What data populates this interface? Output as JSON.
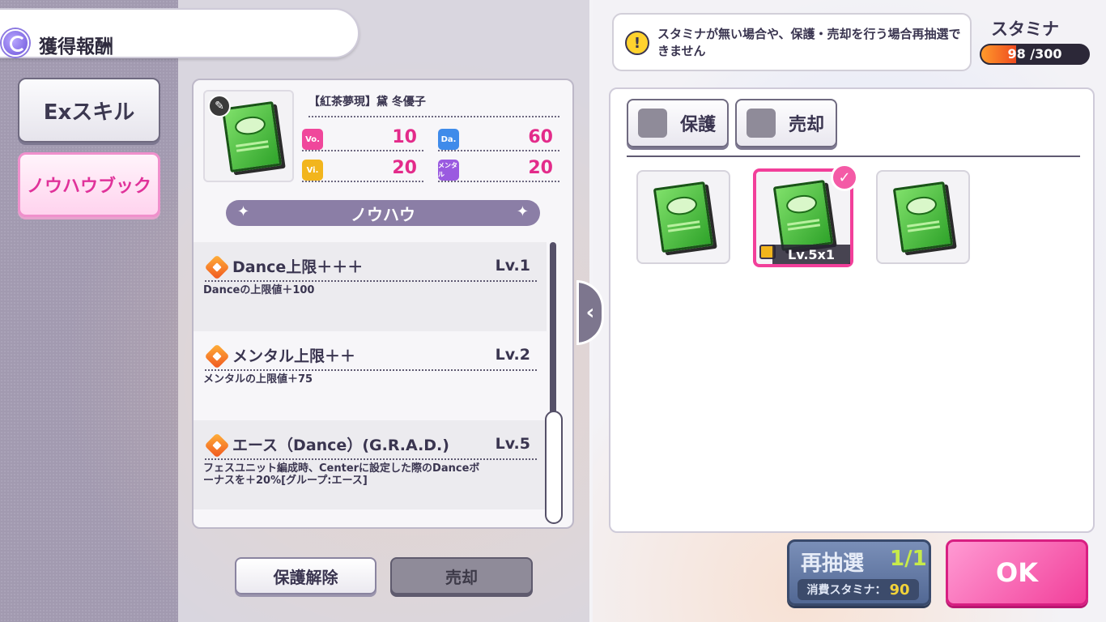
{
  "header": {
    "title": "獲得報酬"
  },
  "tabs": [
    {
      "label": "Exスキル"
    },
    {
      "label": "ノウハウブック"
    }
  ],
  "item": {
    "name": "【紅茶夢現】黛 冬優子",
    "stats": [
      {
        "badge": "Vo.",
        "value": "10",
        "color": "#f0479b"
      },
      {
        "badge": "Da.",
        "value": "60",
        "color": "#3f8bea"
      },
      {
        "badge": "Vi.",
        "value": "20",
        "color": "#f2b51d"
      },
      {
        "badge": "メンタル",
        "value": "20",
        "color": "#9a5ae0"
      }
    ]
  },
  "knowhow": {
    "heading": "ノウハウ",
    "skills": [
      {
        "name": "Dance上限＋＋＋",
        "level": "Lv.1",
        "desc": "Danceの上限値＋100"
      },
      {
        "name": "メンタル上限＋＋",
        "level": "Lv.2",
        "desc": "メンタルの上限値＋75"
      },
      {
        "name": "エース（Dance）(G.R.A.D.)",
        "level": "Lv.5",
        "desc": "フェスユニット編成時、Centerに設定した際のDanceボーナスを＋20%[グループ:エース]"
      }
    ]
  },
  "actions": {
    "unprotect": "保護解除",
    "sell": "売却"
  },
  "notice": {
    "text": "スタミナが無い場合や、保護・売却を行う場合再抽選できません"
  },
  "stamina": {
    "label": "スタミナ",
    "current": 98,
    "max": 300,
    "display": "98 /300"
  },
  "inventory": {
    "filters": [
      {
        "label": "保護"
      },
      {
        "label": "売却"
      }
    ],
    "cards": [
      {
        "selected": false,
        "level": ""
      },
      {
        "selected": true,
        "level": "Lv.5x1"
      },
      {
        "selected": false,
        "level": ""
      }
    ]
  },
  "reroll": {
    "label": "再抽選",
    "count": "1/1",
    "cost_label": "消費スタミナ：",
    "cost": "90"
  },
  "ok": {
    "label": "OK"
  }
}
